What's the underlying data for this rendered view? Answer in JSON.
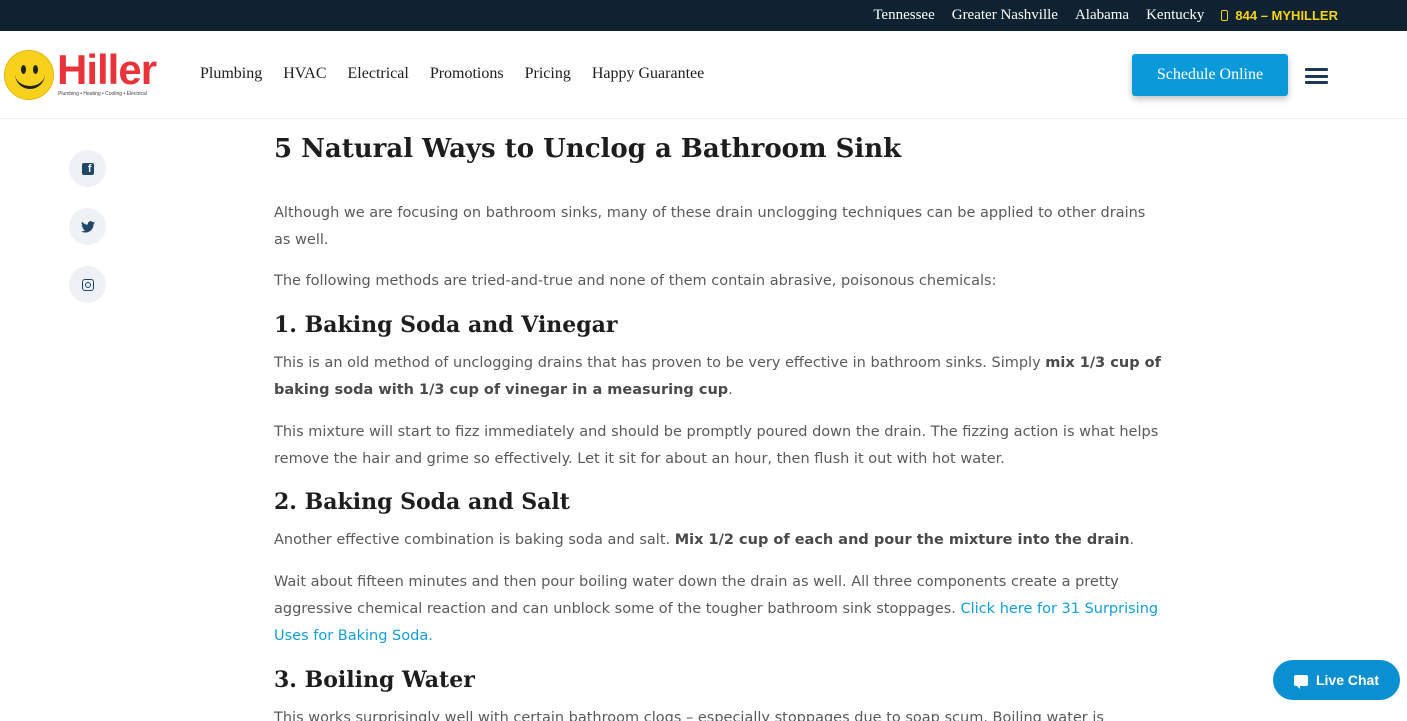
{
  "topbar": {
    "links": [
      "Tennessee",
      "Greater Nashville",
      "Alabama",
      "Kentucky"
    ],
    "phone": "844 – MYHILLER"
  },
  "header": {
    "logo": {
      "wordmark": "Hiller",
      "tagline": "Plumbing • Heating • Cooling • Electrical"
    },
    "nav": [
      "Plumbing",
      "HVAC",
      "Electrical",
      "Promotions",
      "Pricing",
      "Happy Guarantee"
    ],
    "schedule_label": "Schedule Online"
  },
  "social": {
    "icons": [
      "facebook-icon",
      "twitter-icon",
      "instagram-icon"
    ]
  },
  "article": {
    "title": "5 Natural Ways to Unclog a Bathroom Sink",
    "intro1": "Although we are focusing on bathroom sinks, many of these drain unclogging techniques can be applied to other drains as well.",
    "intro2": "The following methods are tried-and-true and none of them contain abrasive, poisonous chemicals:",
    "s1": {
      "heading": "1. Baking Soda and Vinegar",
      "p1_a": "This is an old method of unclogging drains that has proven to be very effective in bathroom sinks. Simply ",
      "p1_b": "mix 1/3 cup of baking soda with 1/3 cup of vinegar in a measuring cup",
      "p1_c": ".",
      "p2": "This mixture will start to fizz immediately and should be promptly poured down the drain. The fizzing action is what helps remove the hair and grime so effectively. Let it sit for about an hour, then flush it out with hot water."
    },
    "s2": {
      "heading": "2. Baking Soda and Salt",
      "p1_a": "Another effective combination is baking soda and salt. ",
      "p1_b": "Mix 1/2 cup of each and pour the mixture into the drain",
      "p1_c": ".",
      "p2_a": "Wait about fifteen minutes and then pour boiling water down the drain as well. All three components create a pretty aggressive chemical reaction and can unblock some of the tougher bathroom sink stoppages. ",
      "p2_link": "Click here for 31 Surprising Uses for Baking Soda."
    },
    "s3": {
      "heading": "3. Boiling Water",
      "p1": "This works surprisingly well with certain bathroom clogs – especially stoppages due to soap scum. Boiling water is"
    }
  },
  "live_chat": {
    "label": "Live Chat"
  },
  "colors": {
    "topbar_bg": "#0f2231",
    "phone": "#f7d21a",
    "brand_red": "#e8333a",
    "accent_blue": "#0a9ad9",
    "link": "#129fd8"
  }
}
